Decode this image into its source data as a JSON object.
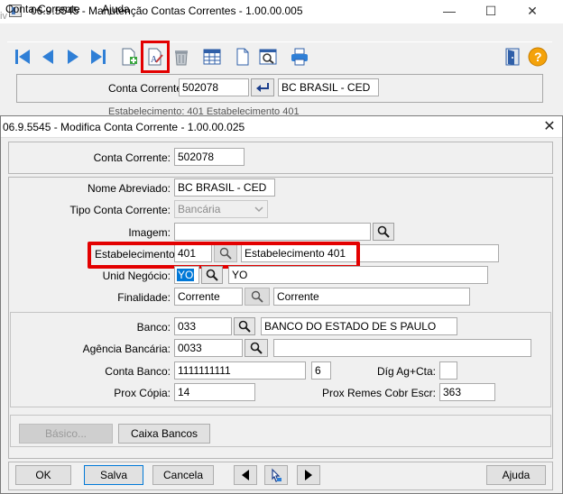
{
  "main_window": {
    "title": "06.9.5545 - Manutenção Contas Correntes - 1.00.00.005",
    "left_strip": "iv",
    "controls": {
      "minimize": "—",
      "maximize": "☐",
      "close": "✕"
    },
    "menu": [
      "Conta-Corrente",
      "Ajuda"
    ],
    "toolbar": [
      "first-record-icon",
      "previous-record-icon",
      "next-record-icon",
      "last-record-icon",
      "new-record-icon",
      "modify-record-icon",
      "delete-record-icon",
      "grid-view-icon",
      "document-icon",
      "zoom-window-icon",
      "print-icon",
      "exit-door-icon",
      "help-icon"
    ],
    "highlighted_tool": "modify-record-icon",
    "conta_corrente_label": "Conta Corrente:",
    "conta_corrente_value": "502078",
    "conta_corrente_desc": "BC BRASIL - CED",
    "obscured_text": "Estabelecimento: 401   Estabelecimento 401"
  },
  "dialog": {
    "title": "06.9.5545 - Modifica Conta Corrente - 1.00.00.025",
    "close": "✕",
    "fields": {
      "conta_corrente": {
        "label": "Conta Corrente:",
        "value": "502078"
      },
      "nome_abreviado": {
        "label": "Nome Abreviado:",
        "value": "BC BRASIL - CED"
      },
      "tipo_conta": {
        "label": "Tipo Conta Corrente:",
        "value": "Bancária"
      },
      "imagem": {
        "label": "Imagem:",
        "value": ""
      },
      "estabelecimento": {
        "label": "Estabelecimento:",
        "value": "401",
        "desc": "Estabelecimento 401"
      },
      "unid_negocio": {
        "label": "Unid Negócio:",
        "value": "YO",
        "desc": "YO"
      },
      "finalidade": {
        "label": "Finalidade:",
        "value": "Corrente",
        "desc": "Corrente"
      },
      "banco": {
        "label": "Banco:",
        "value": "033",
        "desc": "BANCO DO ESTADO DE S PAULO"
      },
      "agencia": {
        "label": "Agência Bancária:",
        "value": "0033",
        "desc": ""
      },
      "conta_banco": {
        "label": "Conta Banco:",
        "value": "1111111111",
        "digito": "6"
      },
      "dig_ag_cta": {
        "label": "Díg Ag+Cta:",
        "value": ""
      },
      "prox_copia": {
        "label": "Prox Cópia:",
        "value": "14"
      },
      "prox_remes": {
        "label": "Prox Remes Cobr Escr:",
        "value": "363"
      }
    },
    "buttons": {
      "basico": "Básico...",
      "caixa_bancos": "Caixa Bancos",
      "ok": "OK",
      "salva": "Salva",
      "cancela": "Cancela",
      "ajuda": "Ajuda"
    },
    "nav_icons": [
      "previous-arrow-icon",
      "pointer-hand-icon",
      "next-arrow-icon"
    ]
  },
  "colors": {
    "highlight": "#e30000",
    "selection": "#0078d7",
    "window_bg": "#f0f0f0",
    "toolbar_blue": "#2f7fd6"
  }
}
